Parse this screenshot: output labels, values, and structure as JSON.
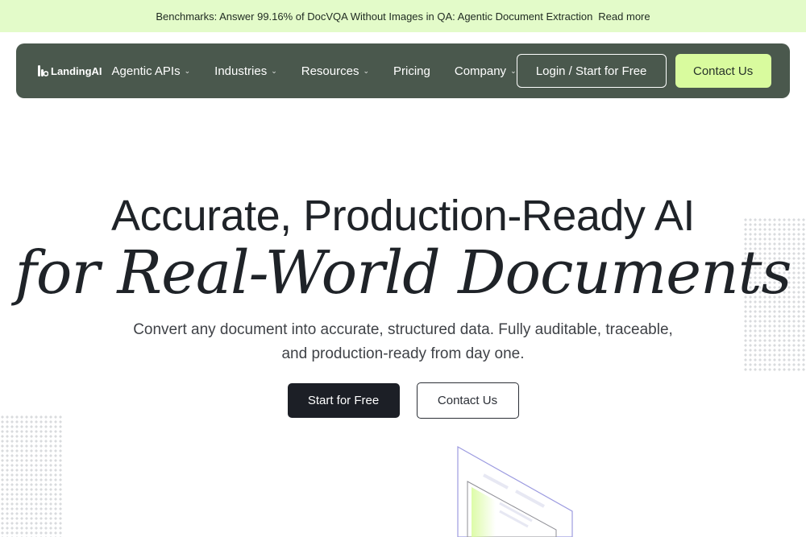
{
  "banner": {
    "text": "Benchmarks: Answer 99.16% of DocVQA Without Images in QA: Agentic Document Extraction",
    "link": "Read more"
  },
  "nav": {
    "logo": "LandingAI",
    "items": [
      {
        "label": "Agentic APIs",
        "dropdown": true
      },
      {
        "label": "Industries",
        "dropdown": true
      },
      {
        "label": "Resources",
        "dropdown": true
      },
      {
        "label": "Pricing",
        "dropdown": false
      },
      {
        "label": "Company",
        "dropdown": true
      }
    ],
    "login_label": "Login / Start for Free",
    "contact_label": "Contact Us",
    "chevron": "⌄"
  },
  "hero": {
    "headline": "Accurate, Production-Ready AI",
    "headline_italic": "for Real-World Documents",
    "subtitle_line1": "Convert any document into accurate, structured data. Fully auditable, traceable,",
    "subtitle_line2": "and production-ready from day one.",
    "primary_button": "Start for Free",
    "secondary_button": "Contact Us"
  },
  "colors": {
    "banner_bg": "#e3fbc9",
    "nav_bg": "#4a584d",
    "accent_lime": "#d9fb9e",
    "dark_button": "#1c1f26"
  },
  "icons": {
    "logo_icon": "landingai-logo-icon",
    "dropdown": "chevron-down-icon"
  }
}
